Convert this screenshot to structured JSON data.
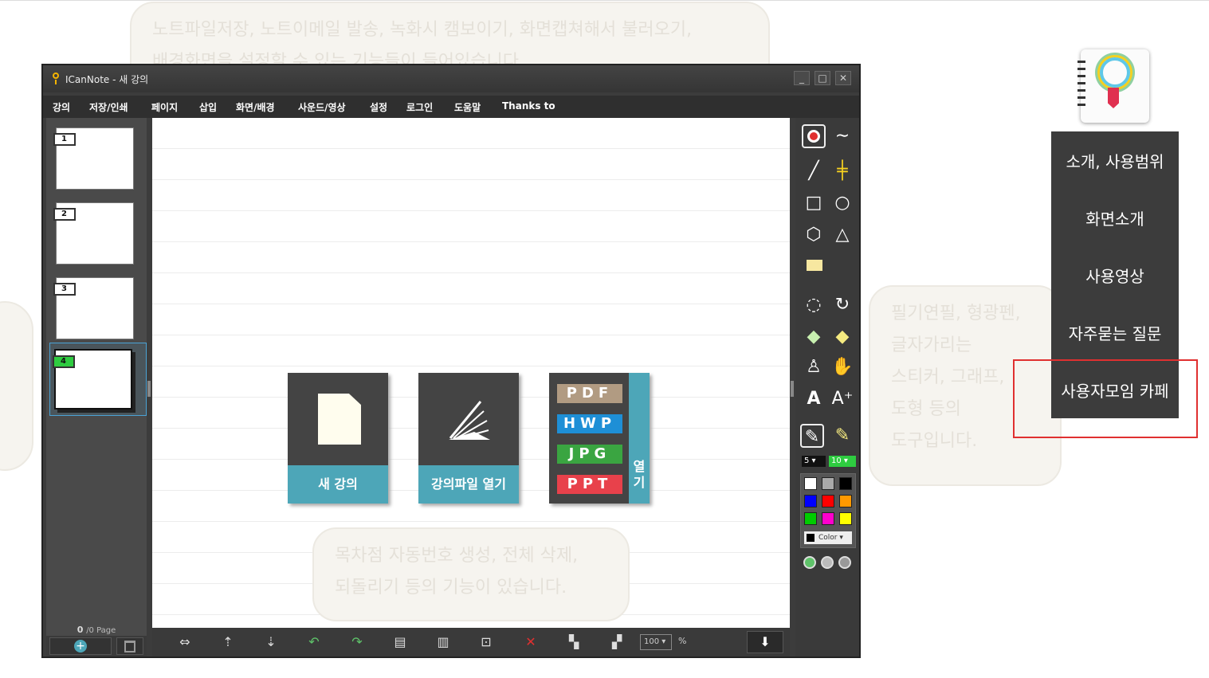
{
  "window": {
    "title": "ICanNote - 새 강의"
  },
  "menu": [
    "강의",
    "저장/인쇄",
    "페이지",
    "삽입",
    "화면/배경",
    "사운드/영상",
    "설정",
    "로그인",
    "도움말",
    "Thanks to"
  ],
  "bubbles": {
    "top": [
      "노트파일저장, 노트이메일 발송, 녹화시 캠보이기, 화면캡쳐해서 불러오기,",
      "배경화면을 설정할 수 있는 기능들이 들어있습니다."
    ],
    "right": [
      "필기연필, 형광펜,",
      "글자가리는",
      "스티커, 그래프,",
      "도형 등의",
      "도구입니다."
    ],
    "bottom": [
      "목차점 자동번호 생성, 전체 삭제,",
      "되돌리기 등의 기능이 있습니다."
    ]
  },
  "pages": [
    "1",
    "2",
    "3",
    "4"
  ],
  "page_status": {
    "current": "0",
    "total": "/0 Page"
  },
  "tiles": {
    "new_lecture": "새 강의",
    "open_file": "강의파일 열기",
    "open_label": "열기"
  },
  "file_types": [
    {
      "label": "PDF",
      "color": "#b19b82"
    },
    {
      "label": "HWP",
      "color": "#1e8fd6"
    },
    {
      "label": "JPG",
      "color": "#3aa541"
    },
    {
      "label": "PPT",
      "color": "#e8414b"
    }
  ],
  "pen_size": "5",
  "pen_size2": "10",
  "color_label": "Color",
  "zoom": {
    "value": "100",
    "unit": "%"
  },
  "palette": [
    "#ffffff",
    "#aaaaaa",
    "#000000",
    "#0000ff",
    "#ff0000",
    "#ff9900",
    "#00cc00",
    "#ff00cc",
    "#ffff00"
  ],
  "right_menu": [
    "소개, 사용범위",
    "화면소개",
    "사용영상",
    "자주묻는 질문",
    "사용자모임 카페"
  ],
  "colors": {
    "accent": "#4da6b8",
    "highlight": "#e03030"
  }
}
